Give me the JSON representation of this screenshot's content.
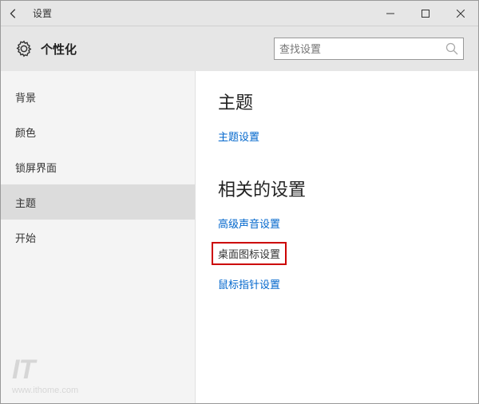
{
  "titlebar": {
    "title": "设置"
  },
  "header": {
    "heading": "个性化"
  },
  "search": {
    "placeholder": "查找设置"
  },
  "sidebar": {
    "items": [
      {
        "label": "背景",
        "selected": false
      },
      {
        "label": "颜色",
        "selected": false
      },
      {
        "label": "锁屏界面",
        "selected": false
      },
      {
        "label": "主题",
        "selected": true
      },
      {
        "label": "开始",
        "selected": false
      }
    ]
  },
  "content": {
    "section1_title": "主题",
    "link_theme_settings": "主题设置",
    "section2_title": "相关的设置",
    "link_sound": "高级声音设置",
    "link_desktop_icons": "桌面图标设置",
    "link_mouse_pointer": "鼠标指针设置"
  },
  "watermark": {
    "logo": "IT",
    "url": "www.ithome.com"
  }
}
